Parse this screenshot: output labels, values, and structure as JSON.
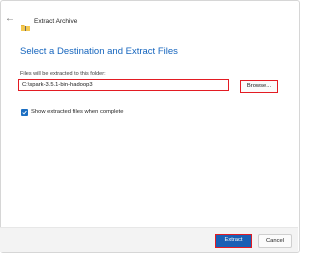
{
  "window": {
    "title": "Extract Archive",
    "back_icon": "arrow-left-icon",
    "folder_icon": "zip-folder-icon"
  },
  "main": {
    "heading": "Select a Destination and Extract Files",
    "destination_label": "Files will be extracted to this folder:",
    "destination_path": "C:\\spark-3.5.1-bin-hadoop3",
    "browse_label": "Browse...",
    "show_files_checkbox": {
      "label": "Show extracted files when complete",
      "checked": true
    }
  },
  "footer": {
    "extract_label": "Extract",
    "cancel_label": "Cancel"
  },
  "colors": {
    "accent": "#1a5fb4",
    "heading": "#1464bd",
    "highlight_border": "#e31c23",
    "folder": "#e8b63d"
  }
}
